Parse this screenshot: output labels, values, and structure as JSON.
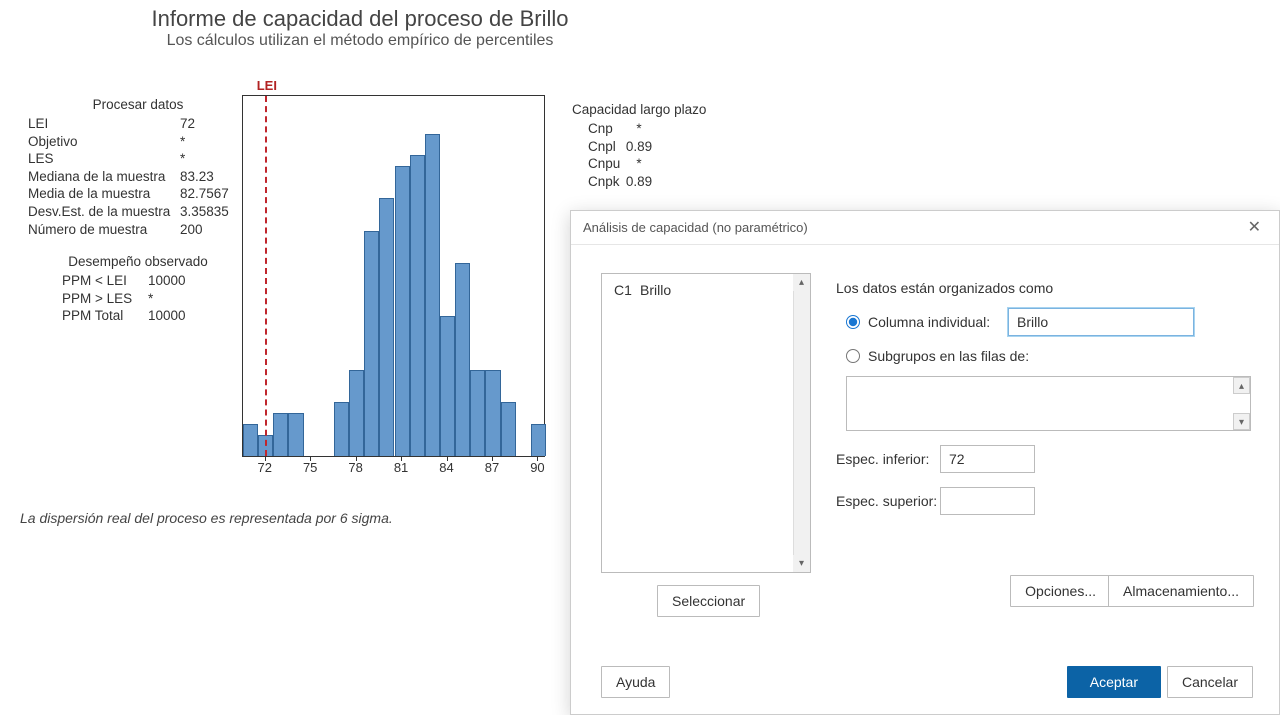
{
  "report": {
    "title": "Informe de capacidad del proceso de Brillo",
    "subtitle": "Los cálculos utilizan el método empírico de percentiles",
    "footnote": "La dispersión real del proceso es representada por 6 sigma."
  },
  "process_data": {
    "header": "Procesar datos",
    "rows": [
      {
        "label": "LEI",
        "value": "72"
      },
      {
        "label": "Objetivo",
        "value": "*"
      },
      {
        "label": "LES",
        "value": "*"
      },
      {
        "label": "Mediana de la muestra",
        "value": "83.23"
      },
      {
        "label": "Media de la muestra",
        "value": "82.7567"
      },
      {
        "label": "Desv.Est. de la muestra",
        "value": "3.35835"
      },
      {
        "label": "Número de muestra",
        "value": "200"
      }
    ]
  },
  "observed_perf": {
    "header": "Desempeño observado",
    "rows": [
      {
        "label": "PPM < LEI",
        "value": "10000"
      },
      {
        "label": "PPM > LES",
        "value": "*"
      },
      {
        "label": "PPM Total",
        "value": "10000"
      }
    ]
  },
  "long_term": {
    "header": "Capacidad largo plazo",
    "rows": [
      {
        "label": "Cnp",
        "value": "*"
      },
      {
        "label": "Cnpl",
        "value": "0.89"
      },
      {
        "label": "Cnpu",
        "value": "*"
      },
      {
        "label": "Cnpk",
        "value": "0.89"
      }
    ]
  },
  "chart_data": {
    "type": "bar",
    "lei_label": "LEI",
    "lei_x": 72,
    "x_ticks": [
      72,
      75,
      78,
      81,
      84,
      87,
      90
    ],
    "bins": [
      70.5,
      71.5,
      72.5,
      73.5,
      74.5,
      75.5,
      76.5,
      77.5,
      78.5,
      79.5,
      80.5,
      81.5,
      82.5,
      83.5,
      84.5,
      85.5,
      86.5,
      87.5,
      88.5,
      89.5,
      90.5
    ],
    "counts": [
      3,
      2,
      4,
      4,
      0,
      0,
      5,
      8,
      21,
      24,
      27,
      28,
      30,
      13,
      18,
      8,
      8,
      5,
      0,
      3
    ],
    "ymax": 30,
    "title": "",
    "xlabel": "",
    "ylabel": ""
  },
  "dialog": {
    "title": "Análisis de capacidad (no paramétrico)",
    "columns": [
      {
        "key": "C1",
        "name": "Brillo"
      }
    ],
    "organized_label": "Los datos están organizados como",
    "radio_individual": "Columna individual:",
    "radio_subgroups": "Subgrupos en las filas de:",
    "individual_value": "Brillo",
    "spec_lower_label": "Espec. inferior:",
    "spec_lower_value": "72",
    "spec_upper_label": "Espec. superior:",
    "spec_upper_value": "",
    "select_btn": "Seleccionar",
    "options_btn": "Opciones...",
    "storage_btn": "Almacenamiento...",
    "help_btn": "Ayuda",
    "accept_btn": "Aceptar",
    "cancel_btn": "Cancelar"
  }
}
